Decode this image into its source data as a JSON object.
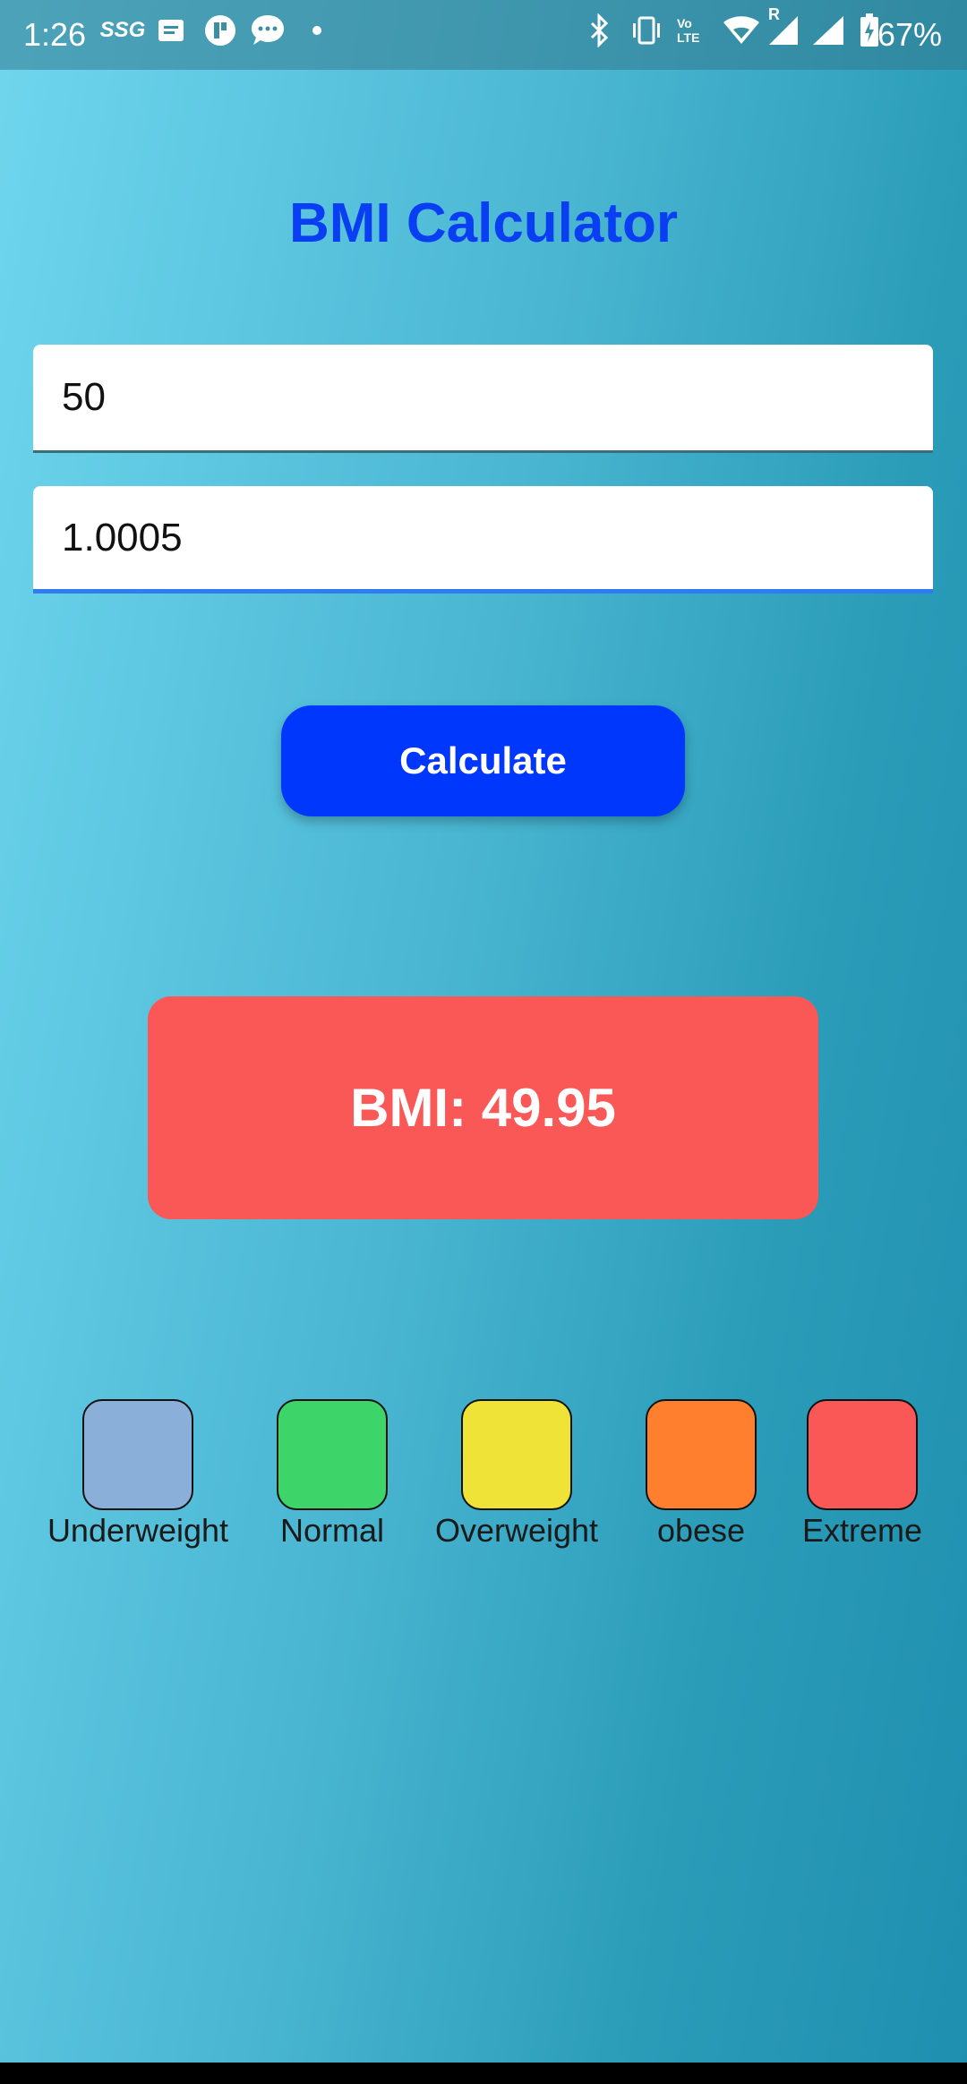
{
  "status_bar": {
    "time": "1:26",
    "notification_icons": [
      "ssg-icon",
      "message-icon",
      "app-icon",
      "chat-icon",
      "dot-icon"
    ],
    "system_icons": [
      "bluetooth-icon",
      "vibrate-icon",
      "volte-icon",
      "wifi-icon",
      "signal-roaming-icon",
      "signal-icon",
      "battery-icon"
    ],
    "carrier_tag": "SSG",
    "volte_tag": "Vo LTE",
    "roaming_tag": "R",
    "battery": "67%"
  },
  "app": {
    "title": "BMI Calculator",
    "title_color": "#0a3ef2"
  },
  "inputs": {
    "weight": {
      "value": "50",
      "placeholder": ""
    },
    "height": {
      "value": "1.0005",
      "placeholder": ""
    }
  },
  "actions": {
    "calculate_label": "Calculate",
    "button_color": "#0037fc"
  },
  "result": {
    "text": "BMI: 49.95",
    "color": "#fa5757"
  },
  "legend": [
    {
      "label": "Underweight",
      "color": "#8aafd8"
    },
    {
      "label": "Normal",
      "color": "#3dd46a"
    },
    {
      "label": "Overweight",
      "color": "#eee336"
    },
    {
      "label": "obese",
      "color": "#ff7f2f"
    },
    {
      "label": "Extreme",
      "color": "#fa5757"
    }
  ]
}
